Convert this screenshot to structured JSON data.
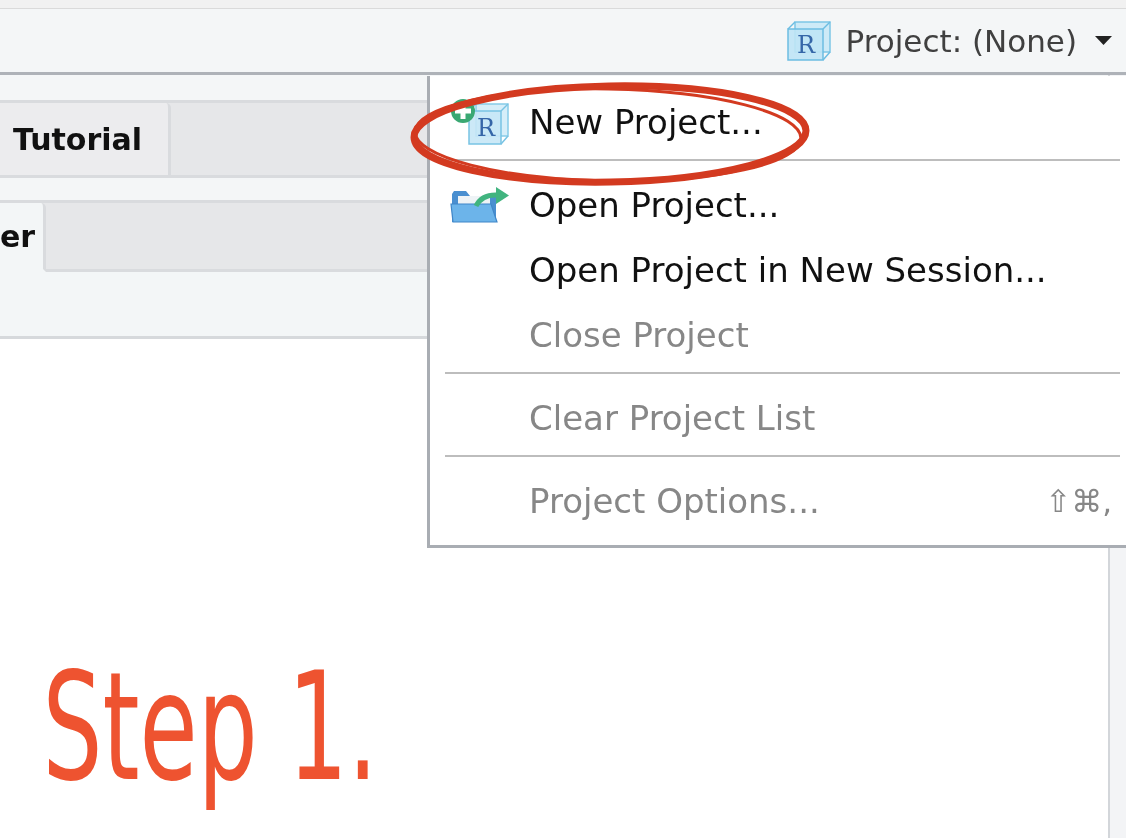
{
  "toolbar": {
    "project_button": {
      "icon_letter": "R",
      "label": "Project: (None)"
    }
  },
  "tabs_upper": [
    {
      "label": "Tutorial",
      "selected": false
    }
  ],
  "tabs_lower": [
    {
      "label": "er",
      "selected": true
    }
  ],
  "project_menu": {
    "groups": [
      {
        "items": [
          {
            "kind": "new",
            "icon_letter": "R",
            "label": "New Project...",
            "disabled": false
          }
        ]
      },
      {
        "items": [
          {
            "kind": "open",
            "label": "Open Project...",
            "disabled": false
          },
          {
            "kind": "plain",
            "label": "Open Project in New Session...",
            "disabled": false
          },
          {
            "kind": "plain",
            "label": "Close Project",
            "disabled": true
          }
        ]
      },
      {
        "items": [
          {
            "kind": "plain",
            "label": "Clear Project List",
            "disabled": true
          }
        ]
      },
      {
        "items": [
          {
            "kind": "plain",
            "label": "Project Options...",
            "disabled": true,
            "shortcut": "⇧⌘,"
          }
        ]
      }
    ]
  },
  "annotation": {
    "text": "Step 1."
  }
}
